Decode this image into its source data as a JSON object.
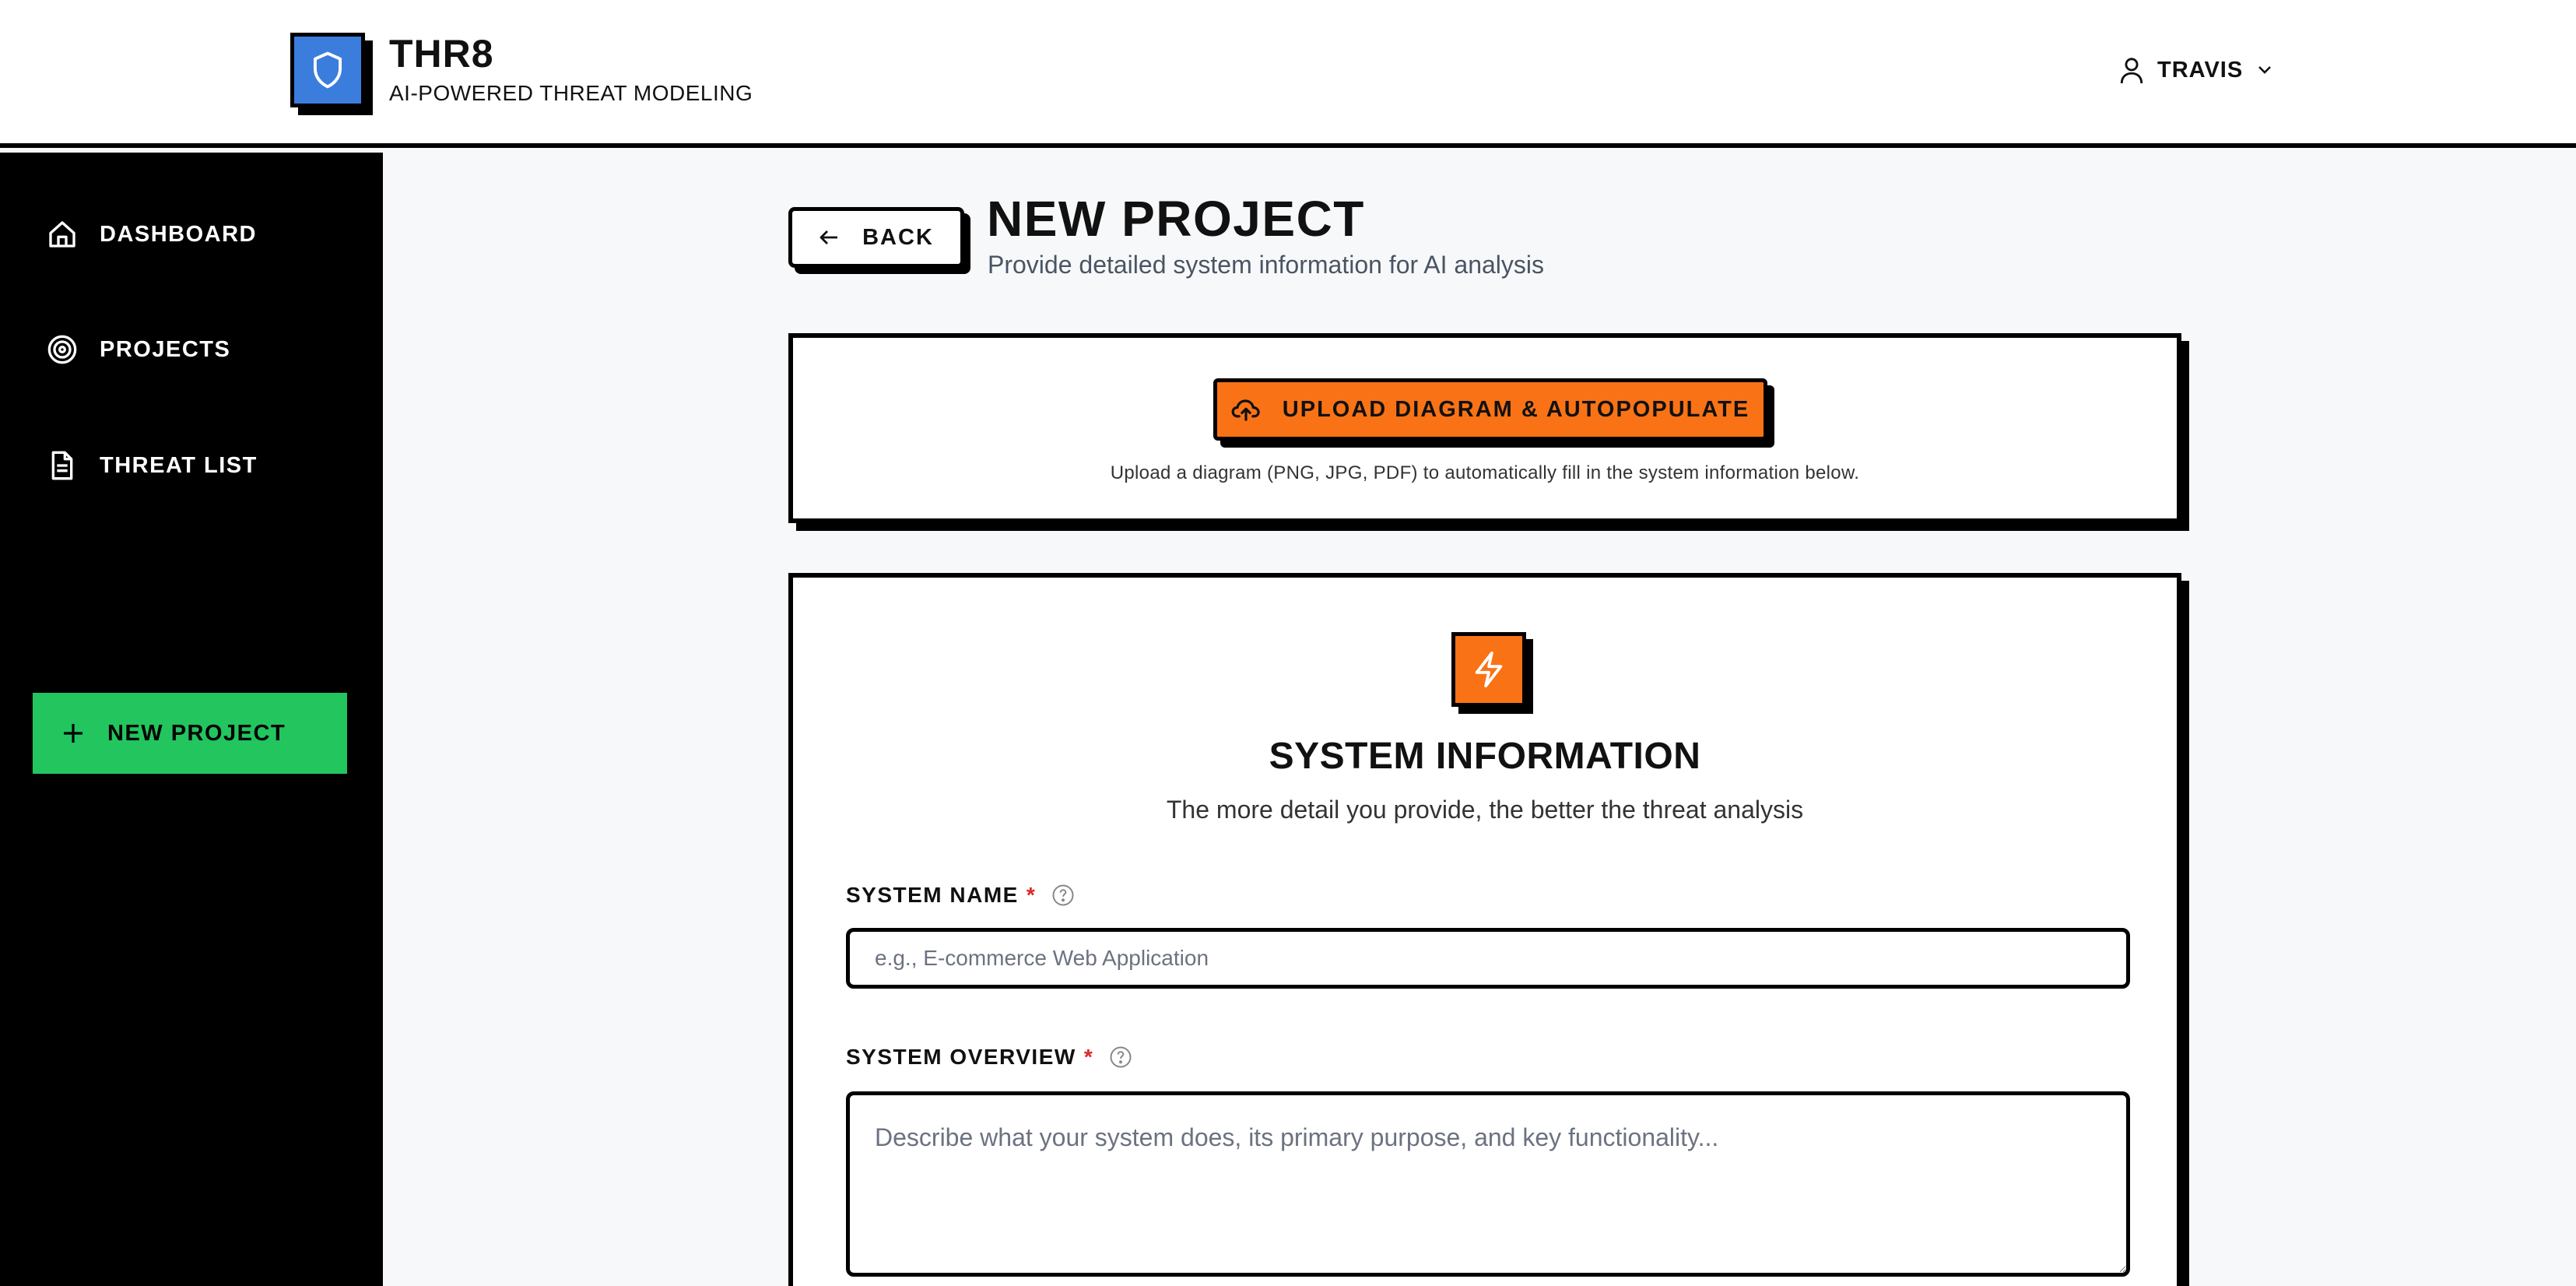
{
  "header": {
    "brand_name": "THR8",
    "brand_tagline": "AI-POWERED THREAT MODELING",
    "user_name": "TRAVIS"
  },
  "sidebar": {
    "items": [
      {
        "label": "DASHBOARD",
        "icon": "home-icon"
      },
      {
        "label": "PROJECTS",
        "icon": "target-icon"
      },
      {
        "label": "THREAT LIST",
        "icon": "document-icon"
      }
    ],
    "new_project_label": "NEW PROJECT"
  },
  "main": {
    "back_label": "BACK",
    "title": "NEW PROJECT",
    "subtitle": "Provide detailed system information for AI analysis",
    "upload": {
      "button_label": "UPLOAD DIAGRAM & AUTOPOPULATE",
      "help_text": "Upload a diagram (PNG, JPG, PDF) to automatically fill in the system information below."
    },
    "system_info": {
      "title": "SYSTEM INFORMATION",
      "subtitle": "The more detail you provide, the better the threat analysis",
      "fields": {
        "system_name": {
          "label": "SYSTEM NAME",
          "required_marker": "*",
          "value": "",
          "placeholder": "e.g., E-commerce Web Application"
        },
        "system_overview": {
          "label": "SYSTEM OVERVIEW",
          "required_marker": "*",
          "value": "",
          "placeholder": "Describe what your system does, its primary purpose, and key functionality..."
        }
      }
    }
  },
  "colors": {
    "brand_blue": "#3b7ddd",
    "accent_orange": "#f97316",
    "new_project_green": "#22c55e",
    "required_red": "#dc2626"
  }
}
